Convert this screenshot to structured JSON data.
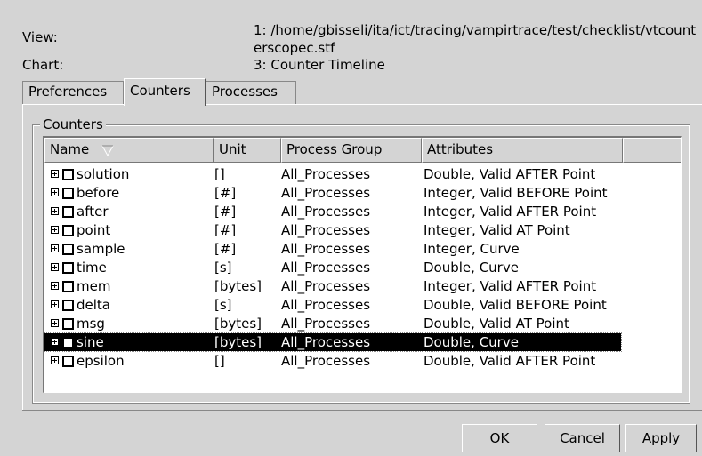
{
  "info": {
    "view_label": "View:",
    "view_value": "1: /home/gbisseli/ita/ict/tracing/vampirtrace/test/checklist/vtcounterscopec.stf",
    "chart_label": "Chart:",
    "chart_value": "3: Counter Timeline"
  },
  "tabs": [
    {
      "label": "Preferences"
    },
    {
      "label": "Counters"
    },
    {
      "label": "Processes"
    }
  ],
  "group_title": "Counters",
  "table": {
    "columns": [
      "Name",
      "Unit",
      "Process Group",
      "Attributes"
    ],
    "sort_indicator": "descending",
    "rows": [
      {
        "name": "solution",
        "unit": "[]",
        "group": "All_Processes",
        "attributes": "Double, Valid AFTER Point"
      },
      {
        "name": "before",
        "unit": "[#]",
        "group": "All_Processes",
        "attributes": "Integer, Valid BEFORE Point"
      },
      {
        "name": "after",
        "unit": "[#]",
        "group": "All_Processes",
        "attributes": "Integer, Valid AFTER Point"
      },
      {
        "name": "point",
        "unit": "[#]",
        "group": "All_Processes",
        "attributes": "Integer, Valid AT Point"
      },
      {
        "name": "sample",
        "unit": "[#]",
        "group": "All_Processes",
        "attributes": "Integer, Curve"
      },
      {
        "name": "time",
        "unit": "[s]",
        "group": "All_Processes",
        "attributes": "Double, Curve"
      },
      {
        "name": "mem",
        "unit": "[bytes]",
        "group": "All_Processes",
        "attributes": "Integer, Valid AFTER Point"
      },
      {
        "name": "delta",
        "unit": "[s]",
        "group": "All_Processes",
        "attributes": "Double, Valid BEFORE Point"
      },
      {
        "name": "msg",
        "unit": "[bytes]",
        "group": "All_Processes",
        "attributes": "Double, Valid AT Point"
      },
      {
        "name": "sine",
        "unit": "[bytes]",
        "group": "All_Processes",
        "attributes": "Double, Curve",
        "selected": true
      },
      {
        "name": "epsilon",
        "unit": "[]",
        "group": "All_Processes",
        "attributes": "Double, Valid AFTER Point"
      }
    ]
  },
  "buttons": {
    "ok": "OK",
    "cancel": "Cancel",
    "apply": "Apply"
  }
}
